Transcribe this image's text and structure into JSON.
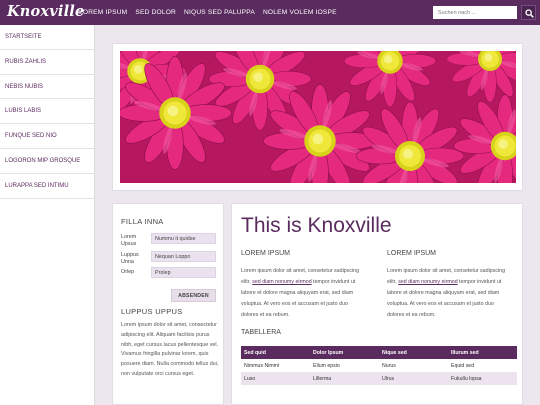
{
  "header": {
    "logo": "Knoxville",
    "nav": [
      "LOREM IPSUM",
      "SED DOLOR",
      "NIQUS SED PALUPPA",
      "NOLEM VOLEM IOSPE"
    ],
    "search_placeholder": "Suchen nach ..."
  },
  "sidebar": {
    "items": [
      "STARTSEITE",
      "RUBIS ZAHLIS",
      "NEBIS NUBIS",
      "LUBIS LABIS",
      "FUNQUE SED NIO",
      "LOGORON MIP GROSQUE",
      "LURAPPA SED INTIMU"
    ]
  },
  "filter": {
    "title": "FILLA INNA",
    "fields": [
      {
        "label": "Lorem Upsus",
        "value": "Nummu it quidse"
      },
      {
        "label": "Luppus Unna",
        "value": "Nequan Loppo"
      },
      {
        "label": "Orlep",
        "value": "Prolep"
      }
    ],
    "submit_label": "ABSENDEN",
    "section2_title": "LUPPUS UPPUS",
    "section2_text": "Lorem ipsum dolor sit amet, consectetur adipiscing elit. Aliquam facilisis purus nibh, eget cursus lacus pellentesque vel. Vivamus fringilla pulvinar lorem, quis posuere diam. Nulla commodo tellus dui, non vulputate orci cursus eget."
  },
  "main": {
    "title": "This is Knoxville",
    "col1": {
      "heading": "LOREM IPSUM",
      "text_before": "Lorem ipsum dolor sit amet, consetetur sadipscing elitr, ",
      "link": "sed diam nonumy eirmod",
      "text_after": " tempor invidunt ut labore et dolore magna aliquyam erat, sed diam voluptua. At vero eos et accusam et justo duo dolores et ea rebum."
    },
    "col2": {
      "heading": "LOREM IPSUM",
      "text_before": "Lorem ipsum dolor sit amet, consetetur sadipscing elitr, ",
      "link": "sed diam nonumy eirmod",
      "text_after": " tempor invidunt ut labore et dolore magna aliquyam erat, sed diam voluptua. At vero eos et accusam et justo duo dolores et ea rebum."
    },
    "table_heading": "TABELLERA",
    "table": {
      "headers": [
        "Sed quid",
        "Dolor Ipsum",
        "Nique sed",
        "Illurum sed"
      ],
      "rows": [
        [
          "Nimmus Nimmi",
          "Ellum epsio",
          "Nurus",
          "Equid sed"
        ],
        [
          "Luso",
          "Lillerma",
          "Ulrus",
          "Fukullu lopsa"
        ]
      ]
    }
  },
  "colors": {
    "accent": "#5a2b5e",
    "background": "#ece7ee",
    "flower": "#c81e6f",
    "flower_center": "#e8e020"
  }
}
